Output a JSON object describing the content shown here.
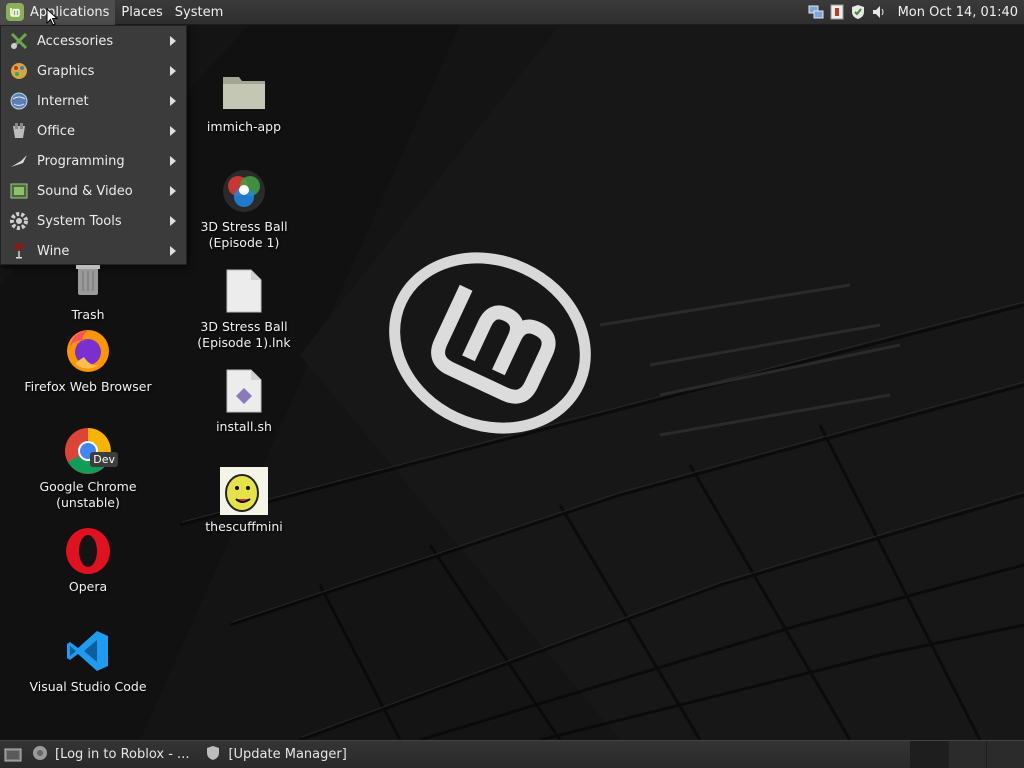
{
  "top_panel": {
    "menus": [
      "Applications",
      "Places",
      "System"
    ],
    "clock": "Mon Oct 14, 01:40"
  },
  "app_menu": {
    "items": [
      {
        "label": "Accessories",
        "icon": "accessories-icon"
      },
      {
        "label": "Graphics",
        "icon": "graphics-icon"
      },
      {
        "label": "Internet",
        "icon": "internet-icon"
      },
      {
        "label": "Office",
        "icon": "office-icon"
      },
      {
        "label": "Programming",
        "icon": "programming-icon"
      },
      {
        "label": "Sound & Video",
        "icon": "sound-video-icon"
      },
      {
        "label": "System Tools",
        "icon": "system-tools-icon"
      },
      {
        "label": "Wine",
        "icon": "wine-icon"
      }
    ]
  },
  "desktop": {
    "left_column": [
      {
        "label": "Trash",
        "icon": "trash-icon"
      },
      {
        "label": "Firefox Web Browser",
        "icon": "firefox-icon"
      },
      {
        "label": "Google Chrome\n(unstable)",
        "icon": "chrome-dev-icon"
      },
      {
        "label": "Opera",
        "icon": "opera-icon"
      },
      {
        "label": "Visual Studio Code",
        "icon": "vscode-icon"
      }
    ],
    "right_column": [
      {
        "label": "immich-app",
        "icon": "folder-icon"
      },
      {
        "label": "3D Stress Ball\n(Episode 1)",
        "icon": "stress-ball-icon"
      },
      {
        "label": "3D Stress Ball\n(Episode 1).lnk",
        "icon": "file-icon"
      },
      {
        "label": "install.sh",
        "icon": "script-icon"
      },
      {
        "label": "thescuffmini",
        "icon": "image-thumbnail-icon"
      }
    ],
    "chrome_badge": "Dev"
  },
  "taskbar": {
    "tasks": [
      {
        "label": "[Log in to Roblox - ...",
        "icon": "chrome-icon"
      },
      {
        "label": "[Update Manager]",
        "icon": "shield-icon"
      }
    ]
  }
}
